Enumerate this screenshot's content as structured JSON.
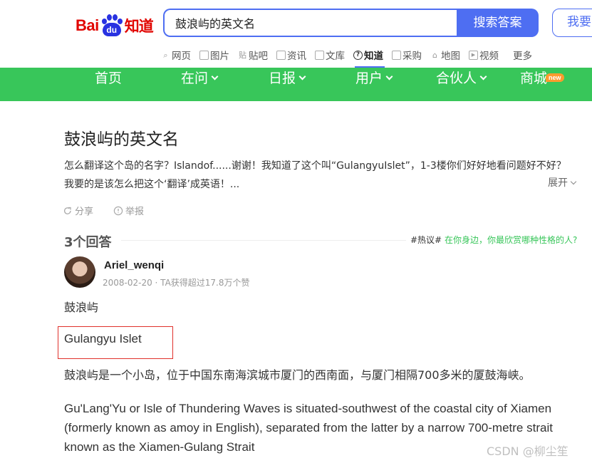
{
  "header": {
    "logo_bai": "Bai",
    "logo_du": "du",
    "logo_zhidao": "知道",
    "search_value": "鼓浪屿的英文名",
    "search_button": "搜索答案",
    "ask_button": "我要"
  },
  "channels": [
    {
      "label": "网页",
      "icon": "search-icon"
    },
    {
      "label": "图片",
      "icon": "image-icon"
    },
    {
      "label": "贴吧",
      "icon": "tieba-icon"
    },
    {
      "label": "资讯",
      "icon": "news-icon"
    },
    {
      "label": "文库",
      "icon": "document-icon"
    },
    {
      "label": "知道",
      "icon": "question-icon",
      "active": true
    },
    {
      "label": "采购",
      "icon": "shop-icon"
    },
    {
      "label": "地图",
      "icon": "map-icon"
    },
    {
      "label": "视频",
      "icon": "video-icon"
    },
    {
      "label": "更多"
    }
  ],
  "menu": {
    "home": "首页",
    "ask": "在问",
    "daily": "日报",
    "user": "用户",
    "partner": "合伙人",
    "mall": "商城",
    "mall_badge": "new"
  },
  "question": {
    "title": "鼓浪屿的英文名",
    "description": "怎么翻译这个岛的名字？Islandof......谢谢！我知道了这个叫“GulangyuIslet”，1-3楼你们好好地看问题好不好？我要的是该怎么把这个‘翻译’成英语！...",
    "expand": "展开",
    "share": "分享",
    "report": "举报"
  },
  "answers": {
    "count_label": "3个回答",
    "hot_tag": "#热议#",
    "hot_text": " 在你身边，你最欣赏哪种性格的人?"
  },
  "answer": {
    "username": "Ariel_wenqi",
    "meta": "2008-02-20 · TA获得超过17.8万个赞",
    "line1": "鼓浪屿",
    "line2": "Gulangyu Islet",
    "para_cn": "鼓浪屿是一个小岛，位于中国东南海滨城市厦门的西南面，与厦门相隔700多米的厦鼓海峡。",
    "para_en": "Gu'Lang'Yu or Isle of Thundering Waves is situated-southwest of the coastal city of Xiamen (formerly known as amoy in English), separated from the latter by a narrow 700-metre strait known as the Xiamen-Gulang Strait"
  },
  "watermark": "CSDN @柳尘笙",
  "colors": {
    "brand_blue": "#4e6ef2",
    "menu_green": "#38c65a",
    "logo_red": "#e10602",
    "highlight_red": "#e0312b"
  }
}
